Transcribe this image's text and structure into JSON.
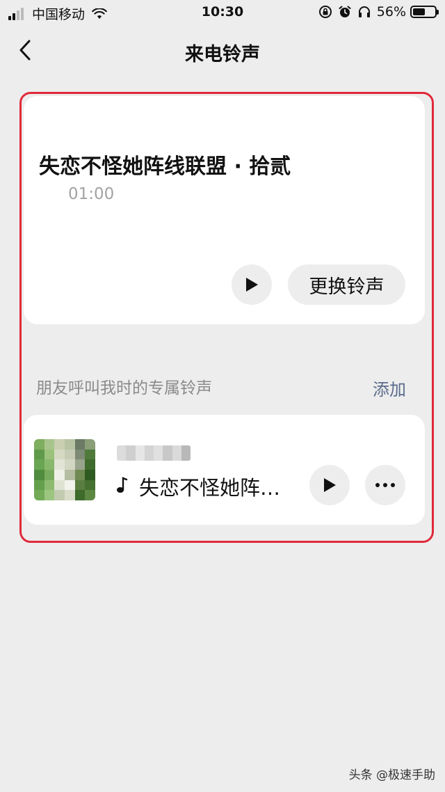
{
  "status_bar": {
    "carrier": "中国移动",
    "time": "10:30",
    "battery_percent": "56%",
    "battery_level": 0.56,
    "icons": [
      "signal-icon",
      "wifi-icon",
      "orientation-lock-icon",
      "alarm-icon",
      "headphones-icon",
      "battery-icon"
    ]
  },
  "nav": {
    "title": "来电铃声",
    "back_icon": "chevron-left-icon"
  },
  "ringtone": {
    "title": "失恋不怪她阵线联盟 · 拾贰",
    "duration": "01:00",
    "play_icon": "play-icon",
    "change_label": "更换铃声"
  },
  "friends_section": {
    "label": "朋友呼叫我时的专属铃声",
    "add_label": "添加"
  },
  "friend_item": {
    "song": "失恋不怪她阵…",
    "note_icon": "music-note-icon",
    "play_icon": "play-icon",
    "more_icon": "more-icon"
  },
  "watermark": "头条 @极速手助",
  "colors": {
    "background": "#ededed",
    "card": "#ffffff",
    "highlight_border": "#e02a3a",
    "link": "#5b6b8c",
    "secondary_text": "#8a8a8a"
  }
}
